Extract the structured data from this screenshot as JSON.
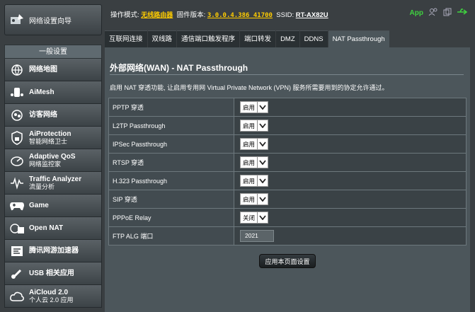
{
  "sidebar": {
    "qis_label": "网络设置向导",
    "section_header": "一般设置",
    "items": [
      {
        "label": "网络地图",
        "sub": "",
        "icon": "globe-icon"
      },
      {
        "label": "AiMesh",
        "sub": "",
        "icon": "aimesh-icon"
      },
      {
        "label": "访客网络",
        "sub": "",
        "icon": "guest-network-icon"
      },
      {
        "label": "AiProtection",
        "sub": "智能网络卫士",
        "icon": "shield-lock-icon"
      },
      {
        "label": "Adaptive QoS",
        "sub": "网络监控家",
        "icon": "gauge-icon"
      },
      {
        "label": "Traffic Analyzer",
        "sub": "流量分析",
        "icon": "waveform-icon"
      },
      {
        "label": "Game",
        "sub": "",
        "icon": "gamepad-icon"
      },
      {
        "label": "Open NAT",
        "sub": "",
        "icon": "open-nat-icon"
      },
      {
        "label": "腾讯网游加速器",
        "sub": "",
        "icon": "tencent-accelerator-icon"
      },
      {
        "label": "USB 相关应用",
        "sub": "",
        "icon": "usb-icon"
      },
      {
        "label": "AiCloud 2.0",
        "sub": "个人云 2.0 应用",
        "icon": "cloud-icon"
      }
    ]
  },
  "topbar": {
    "mode_label": "操作模式:",
    "mode_value": "无线路由器",
    "firmware_label": "固件版本:",
    "firmware_value": "3.0.0.4.386_41700",
    "ssid_label": "SSID:",
    "ssid_value": "RT-AX82U",
    "app_label": "App"
  },
  "tabs": [
    "互联网连接",
    "双线路",
    "通信端口触发程序",
    "端口转发",
    "DMZ",
    "DDNS",
    "NAT Passthrough"
  ],
  "active_tab": "NAT Passthrough",
  "page": {
    "title": "外部网络(WAN) - NAT Passthrough",
    "description": "启用 NAT 穿透功能, 让启用专用网 Virtual Private Network (VPN) 服务所需要用到的协定允许通过。"
  },
  "settings": [
    {
      "label": "PPTP 穿透",
      "type": "select",
      "value": "启用"
    },
    {
      "label": "L2TP Passthrough",
      "type": "select",
      "value": "启用"
    },
    {
      "label": "IPSec Passthrough",
      "type": "select",
      "value": "启用"
    },
    {
      "label": "RTSP 穿透",
      "type": "select",
      "value": "启用"
    },
    {
      "label": "H.323 Passthrough",
      "type": "select",
      "value": "启用"
    },
    {
      "label": "SIP 穿透",
      "type": "select",
      "value": "启用"
    },
    {
      "label": "PPPoE Relay",
      "type": "select",
      "value": "关闭"
    },
    {
      "label": "FTP ALG 端口",
      "type": "input",
      "value": "2021"
    }
  ],
  "apply_label": "应用本页面设置",
  "colors": {
    "accent_yellow": "#ffcc00",
    "app_green": "#3fd13f",
    "panel": "#4c565b"
  }
}
